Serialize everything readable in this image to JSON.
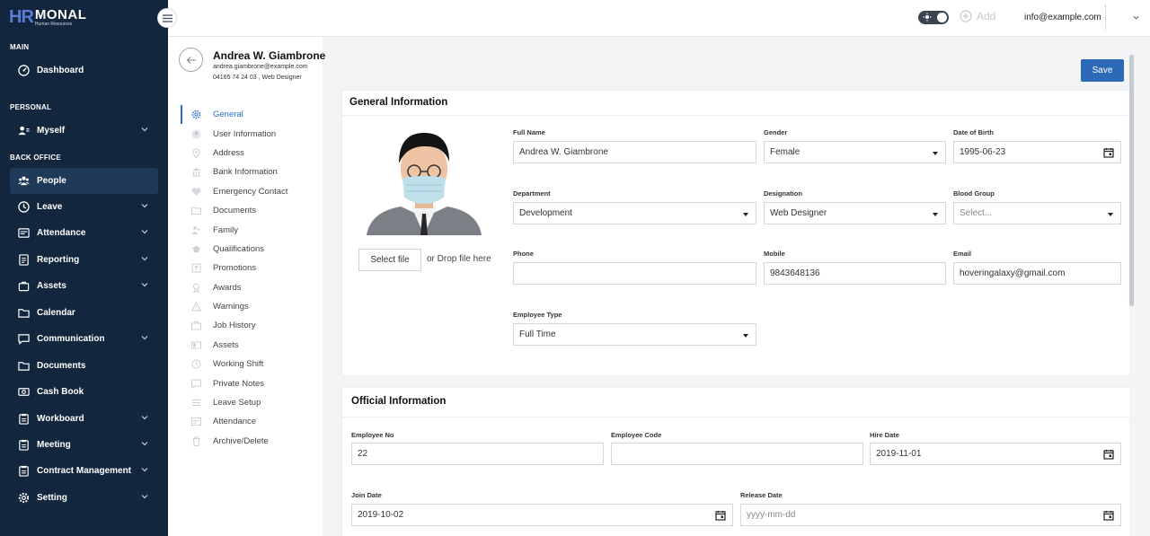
{
  "brand": {
    "mark": "HR",
    "name": "MONAL",
    "subtitle": "Human Resources"
  },
  "sidebar": {
    "sections": {
      "main": "MAIN",
      "personal": "PERSONAL",
      "back_office": "BACK OFFICE"
    },
    "items": [
      {
        "label": "Dashboard",
        "icon": "dashboard-icon"
      },
      {
        "label": "Myself",
        "icon": "user-icon"
      },
      {
        "label": "People",
        "icon": "people-icon"
      },
      {
        "label": "Leave",
        "icon": "clock-icon"
      },
      {
        "label": "Attendance",
        "icon": "attendance-icon"
      },
      {
        "label": "Reporting",
        "icon": "report-icon"
      },
      {
        "label": "Assets",
        "icon": "assets-icon"
      },
      {
        "label": "Calendar",
        "icon": "folder-icon"
      },
      {
        "label": "Communication",
        "icon": "chat-icon"
      },
      {
        "label": "Documents",
        "icon": "folder-icon"
      },
      {
        "label": "Cash Book",
        "icon": "cash-icon"
      },
      {
        "label": "Workboard",
        "icon": "clipboard-icon"
      },
      {
        "label": "Meeting",
        "icon": "clipboard-icon"
      },
      {
        "label": "Contract Management",
        "icon": "clipboard-icon"
      },
      {
        "label": "Setting",
        "icon": "gear-icon"
      }
    ]
  },
  "topbar": {
    "add_label": "Add",
    "user_email": "info@example.com"
  },
  "profile": {
    "name": "Andrea W. Giambrone",
    "email": "andrea.giambrone@example.com",
    "meta": "04165 74 24 03 , Web Designer"
  },
  "submenu": [
    "General",
    "User Information",
    "Address",
    "Bank Information",
    "Emergency Contact",
    "Documents",
    "Family",
    "Qualifications",
    "Promotions",
    "Awards",
    "Warnings",
    "Job History",
    "Assets",
    "Working Shift",
    "Private Notes",
    "Leave Setup",
    "Attendance",
    "Archive/Delete"
  ],
  "actions": {
    "save": "Save"
  },
  "general": {
    "title": "General Information",
    "select_file": "Select file",
    "drop_text": "or Drop file here",
    "full_name": {
      "label": "Full Name",
      "value": "Andrea W. Giambrone"
    },
    "gender": {
      "label": "Gender",
      "value": "Female"
    },
    "dob": {
      "label": "Date of Birth",
      "value": "1995-06-23"
    },
    "department": {
      "label": "Department",
      "value": "Development"
    },
    "designation": {
      "label": "Designation",
      "value": "Web Designer"
    },
    "blood_group": {
      "label": "Blood Group",
      "placeholder": "Select..."
    },
    "phone": {
      "label": "Phone",
      "value": ""
    },
    "mobile": {
      "label": "Mobile",
      "value": "9843648136"
    },
    "email": {
      "label": "Email",
      "value": "hoveringalaxy@gmail.com"
    },
    "employee_type": {
      "label": "Employee Type",
      "value": "Full Time"
    }
  },
  "official": {
    "title": "Official Information",
    "employee_no": {
      "label": "Employee No",
      "value": "22"
    },
    "employee_code": {
      "label": "Employee Code",
      "value": ""
    },
    "hire_date": {
      "label": "Hire Date",
      "value": "2019-11-01"
    },
    "join_date": {
      "label": "Join Date",
      "value": "2019-10-02"
    },
    "release_date": {
      "label": "Release Date",
      "placeholder": "yyyy-mm-dd"
    }
  }
}
